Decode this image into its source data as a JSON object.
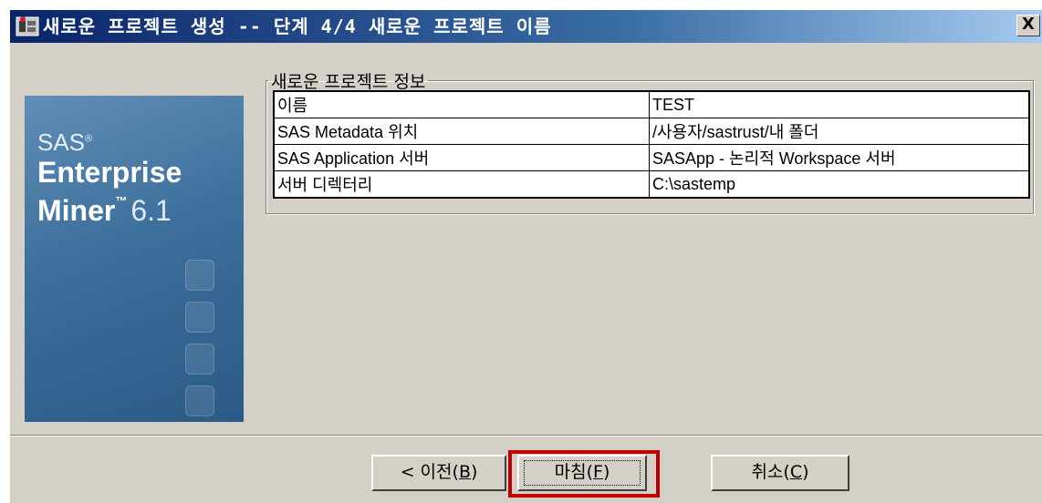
{
  "window": {
    "title": "새로운 프로젝트 생성 -- 단계 4/4 새로운 프로젝트 이름",
    "close_label": "X"
  },
  "sidebar": {
    "brand_sas": "SAS",
    "brand_reg": "®",
    "brand_line1": "Enterprise",
    "brand_line2": "Miner",
    "brand_tm": "™",
    "brand_version": "6.1"
  },
  "group": {
    "title": "새로운 프로젝트 정보",
    "rows": [
      {
        "key": "이름",
        "value": "TEST"
      },
      {
        "key": "SAS Metadata 위치",
        "value": "/사용자/sastrust/내 폴더"
      },
      {
        "key": "SAS Application 서버",
        "value": "SASApp - 논리적 Workspace 서버"
      },
      {
        "key": "서버 디렉터리",
        "value": "C:\\sastemp"
      }
    ]
  },
  "buttons": {
    "back_prefix": "< 이전(",
    "back_key": "B",
    "finish_prefix": "마침(",
    "finish_key": "F",
    "cancel_prefix": "취소(",
    "cancel_key": "C",
    "paren_close": ")"
  },
  "colors": {
    "highlight": "#c00000",
    "titlebar": "#0a246a",
    "face": "#d4d0c8"
  }
}
